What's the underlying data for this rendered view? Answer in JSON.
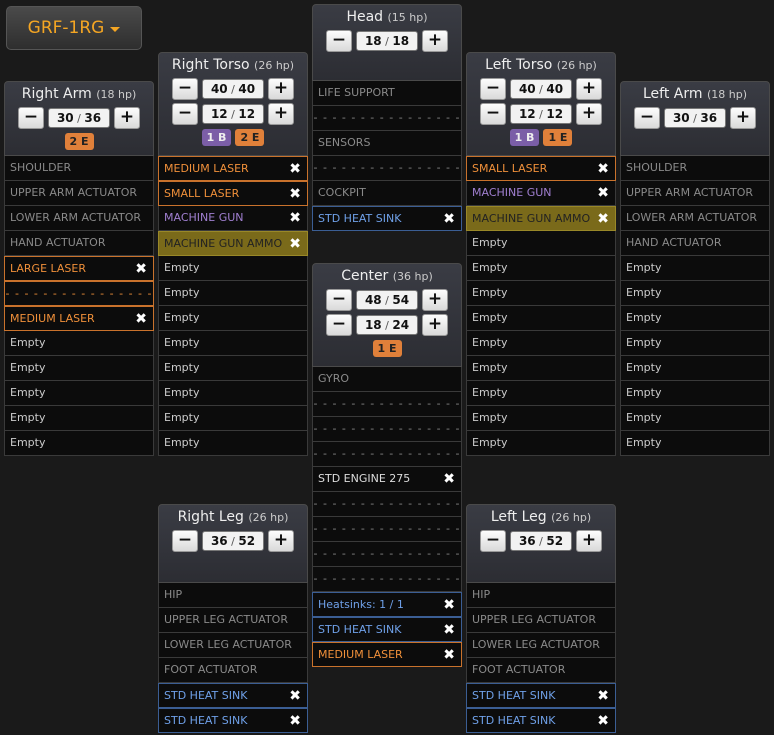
{
  "variant": {
    "label": "GRF-1RG"
  },
  "locations": {
    "right_arm": {
      "name": "Right Arm",
      "hp": "(18 hp)",
      "armor": [
        {
          "cur": "30",
          "max": "36"
        }
      ],
      "badges": [
        {
          "text": "2 E",
          "type": "e"
        }
      ],
      "slots": [
        {
          "text": "SHOULDER",
          "type": "fixed"
        },
        {
          "text": "UPPER ARM ACTUATOR",
          "type": "fixed"
        },
        {
          "text": "LOWER ARM ACTUATOR",
          "type": "fixed"
        },
        {
          "text": "HAND ACTUATOR",
          "type": "fixed"
        },
        {
          "text": "LARGE LASER",
          "type": "energy",
          "removable": true
        },
        {
          "text": "- - - - - - - - - - - - - - - - - -",
          "type": "dash-energy"
        },
        {
          "text": "MEDIUM LASER",
          "type": "energy",
          "removable": true
        },
        {
          "text": "Empty",
          "type": "empty"
        },
        {
          "text": "Empty",
          "type": "empty"
        },
        {
          "text": "Empty",
          "type": "empty"
        },
        {
          "text": "Empty",
          "type": "empty"
        },
        {
          "text": "Empty",
          "type": "empty"
        }
      ]
    },
    "right_torso": {
      "name": "Right Torso",
      "hp": "(26 hp)",
      "armor": [
        {
          "cur": "40",
          "max": "40"
        },
        {
          "cur": "12",
          "max": "12"
        }
      ],
      "badges": [
        {
          "text": "1 B",
          "type": "b"
        },
        {
          "text": "2 E",
          "type": "e"
        }
      ],
      "slots": [
        {
          "text": "MEDIUM LASER",
          "type": "energy",
          "removable": true
        },
        {
          "text": "SMALL LASER",
          "type": "energy",
          "removable": true
        },
        {
          "text": "MACHINE GUN",
          "type": "ballistic",
          "removable": true
        },
        {
          "text": "MACHINE GUN AMMO",
          "type": "ammo",
          "removable": true
        },
        {
          "text": "Empty",
          "type": "empty"
        },
        {
          "text": "Empty",
          "type": "empty"
        },
        {
          "text": "Empty",
          "type": "empty"
        },
        {
          "text": "Empty",
          "type": "empty"
        },
        {
          "text": "Empty",
          "type": "empty"
        },
        {
          "text": "Empty",
          "type": "empty"
        },
        {
          "text": "Empty",
          "type": "empty"
        },
        {
          "text": "Empty",
          "type": "empty"
        }
      ]
    },
    "head": {
      "name": "Head",
      "hp": "(15 hp)",
      "armor": [
        {
          "cur": "18",
          "max": "18"
        }
      ],
      "badges": [],
      "slots": [
        {
          "text": "LIFE SUPPORT",
          "type": "fixed"
        },
        {
          "text": "- - - - - - - - - - - - - - - - - -",
          "type": "dash"
        },
        {
          "text": "SENSORS",
          "type": "fixed"
        },
        {
          "text": "- - - - - - - - - - - - - - - - - -",
          "type": "dash"
        },
        {
          "text": "COCKPIT",
          "type": "fixed"
        },
        {
          "text": "STD HEAT SINK",
          "type": "heat",
          "removable": true
        }
      ]
    },
    "left_torso": {
      "name": "Left Torso",
      "hp": "(26 hp)",
      "armor": [
        {
          "cur": "40",
          "max": "40"
        },
        {
          "cur": "12",
          "max": "12"
        }
      ],
      "badges": [
        {
          "text": "1 B",
          "type": "b"
        },
        {
          "text": "1 E",
          "type": "e"
        }
      ],
      "slots": [
        {
          "text": "SMALL LASER",
          "type": "energy",
          "removable": true
        },
        {
          "text": "MACHINE GUN",
          "type": "ballistic",
          "removable": true
        },
        {
          "text": "MACHINE GUN AMMO",
          "type": "ammo",
          "removable": true
        },
        {
          "text": "Empty",
          "type": "empty"
        },
        {
          "text": "Empty",
          "type": "empty"
        },
        {
          "text": "Empty",
          "type": "empty"
        },
        {
          "text": "Empty",
          "type": "empty"
        },
        {
          "text": "Empty",
          "type": "empty"
        },
        {
          "text": "Empty",
          "type": "empty"
        },
        {
          "text": "Empty",
          "type": "empty"
        },
        {
          "text": "Empty",
          "type": "empty"
        },
        {
          "text": "Empty",
          "type": "empty"
        }
      ]
    },
    "left_arm": {
      "name": "Left Arm",
      "hp": "(18 hp)",
      "armor": [
        {
          "cur": "30",
          "max": "36"
        }
      ],
      "badges": [],
      "slots": [
        {
          "text": "SHOULDER",
          "type": "fixed"
        },
        {
          "text": "UPPER ARM ACTUATOR",
          "type": "fixed"
        },
        {
          "text": "LOWER ARM ACTUATOR",
          "type": "fixed"
        },
        {
          "text": "HAND ACTUATOR",
          "type": "fixed"
        },
        {
          "text": "Empty",
          "type": "empty"
        },
        {
          "text": "Empty",
          "type": "empty"
        },
        {
          "text": "Empty",
          "type": "empty"
        },
        {
          "text": "Empty",
          "type": "empty"
        },
        {
          "text": "Empty",
          "type": "empty"
        },
        {
          "text": "Empty",
          "type": "empty"
        },
        {
          "text": "Empty",
          "type": "empty"
        },
        {
          "text": "Empty",
          "type": "empty"
        }
      ]
    },
    "center": {
      "name": "Center",
      "hp": "(36 hp)",
      "armor": [
        {
          "cur": "48",
          "max": "54"
        },
        {
          "cur": "18",
          "max": "24"
        }
      ],
      "badges": [
        {
          "text": "1 E",
          "type": "e"
        }
      ],
      "slots": [
        {
          "text": "GYRO",
          "type": "fixed"
        },
        {
          "text": "- - - - - - - - - - - - - - - - - -",
          "type": "dash"
        },
        {
          "text": "- - - - - - - - - - - - - - - - - -",
          "type": "dash"
        },
        {
          "text": "- - - - - - - - - - - - - - - - - -",
          "type": "dash"
        },
        {
          "text": "STD ENGINE 275",
          "type": "eng",
          "removable": true
        },
        {
          "text": "- - - - - - - - - - - - - - - - - -",
          "type": "dash"
        },
        {
          "text": "- - - - - - - - - - - - - - - - - -",
          "type": "dash"
        },
        {
          "text": "- - - - - - - - - - - - - - - - - -",
          "type": "dash"
        },
        {
          "text": "- - - - - - - - - - - - - - - - - -",
          "type": "dash"
        },
        {
          "text": "Heatsinks: 1 / 1",
          "type": "heat",
          "removable": true
        },
        {
          "text": "STD HEAT SINK",
          "type": "heat",
          "removable": true
        },
        {
          "text": "MEDIUM LASER",
          "type": "energy",
          "removable": true
        }
      ]
    },
    "right_leg": {
      "name": "Right Leg",
      "hp": "(26 hp)",
      "armor": [
        {
          "cur": "36",
          "max": "52"
        }
      ],
      "badges": [],
      "slots": [
        {
          "text": "HIP",
          "type": "fixed"
        },
        {
          "text": "UPPER LEG ACTUATOR",
          "type": "fixed"
        },
        {
          "text": "LOWER LEG ACTUATOR",
          "type": "fixed"
        },
        {
          "text": "FOOT ACTUATOR",
          "type": "fixed"
        },
        {
          "text": "STD HEAT SINK",
          "type": "heat",
          "removable": true
        },
        {
          "text": "STD HEAT SINK",
          "type": "heat",
          "removable": true
        }
      ]
    },
    "left_leg": {
      "name": "Left Leg",
      "hp": "(26 hp)",
      "armor": [
        {
          "cur": "36",
          "max": "52"
        }
      ],
      "badges": [],
      "slots": [
        {
          "text": "HIP",
          "type": "fixed"
        },
        {
          "text": "UPPER LEG ACTUATOR",
          "type": "fixed"
        },
        {
          "text": "LOWER LEG ACTUATOR",
          "type": "fixed"
        },
        {
          "text": "FOOT ACTUATOR",
          "type": "fixed"
        },
        {
          "text": "STD HEAT SINK",
          "type": "heat",
          "removable": true
        },
        {
          "text": "STD HEAT SINK",
          "type": "heat",
          "removable": true
        }
      ]
    }
  },
  "icons": {
    "remove": "close-icon",
    "decrement": "minus-icon",
    "increment": "plus-icon",
    "dropdown": "caret-down-icon"
  },
  "colors": {
    "accent": "#f5a623",
    "energy": "#f0903a",
    "ballistic": "#a07fd0",
    "ammo": "#7a6a1a",
    "heat": "#6fa0e8"
  }
}
